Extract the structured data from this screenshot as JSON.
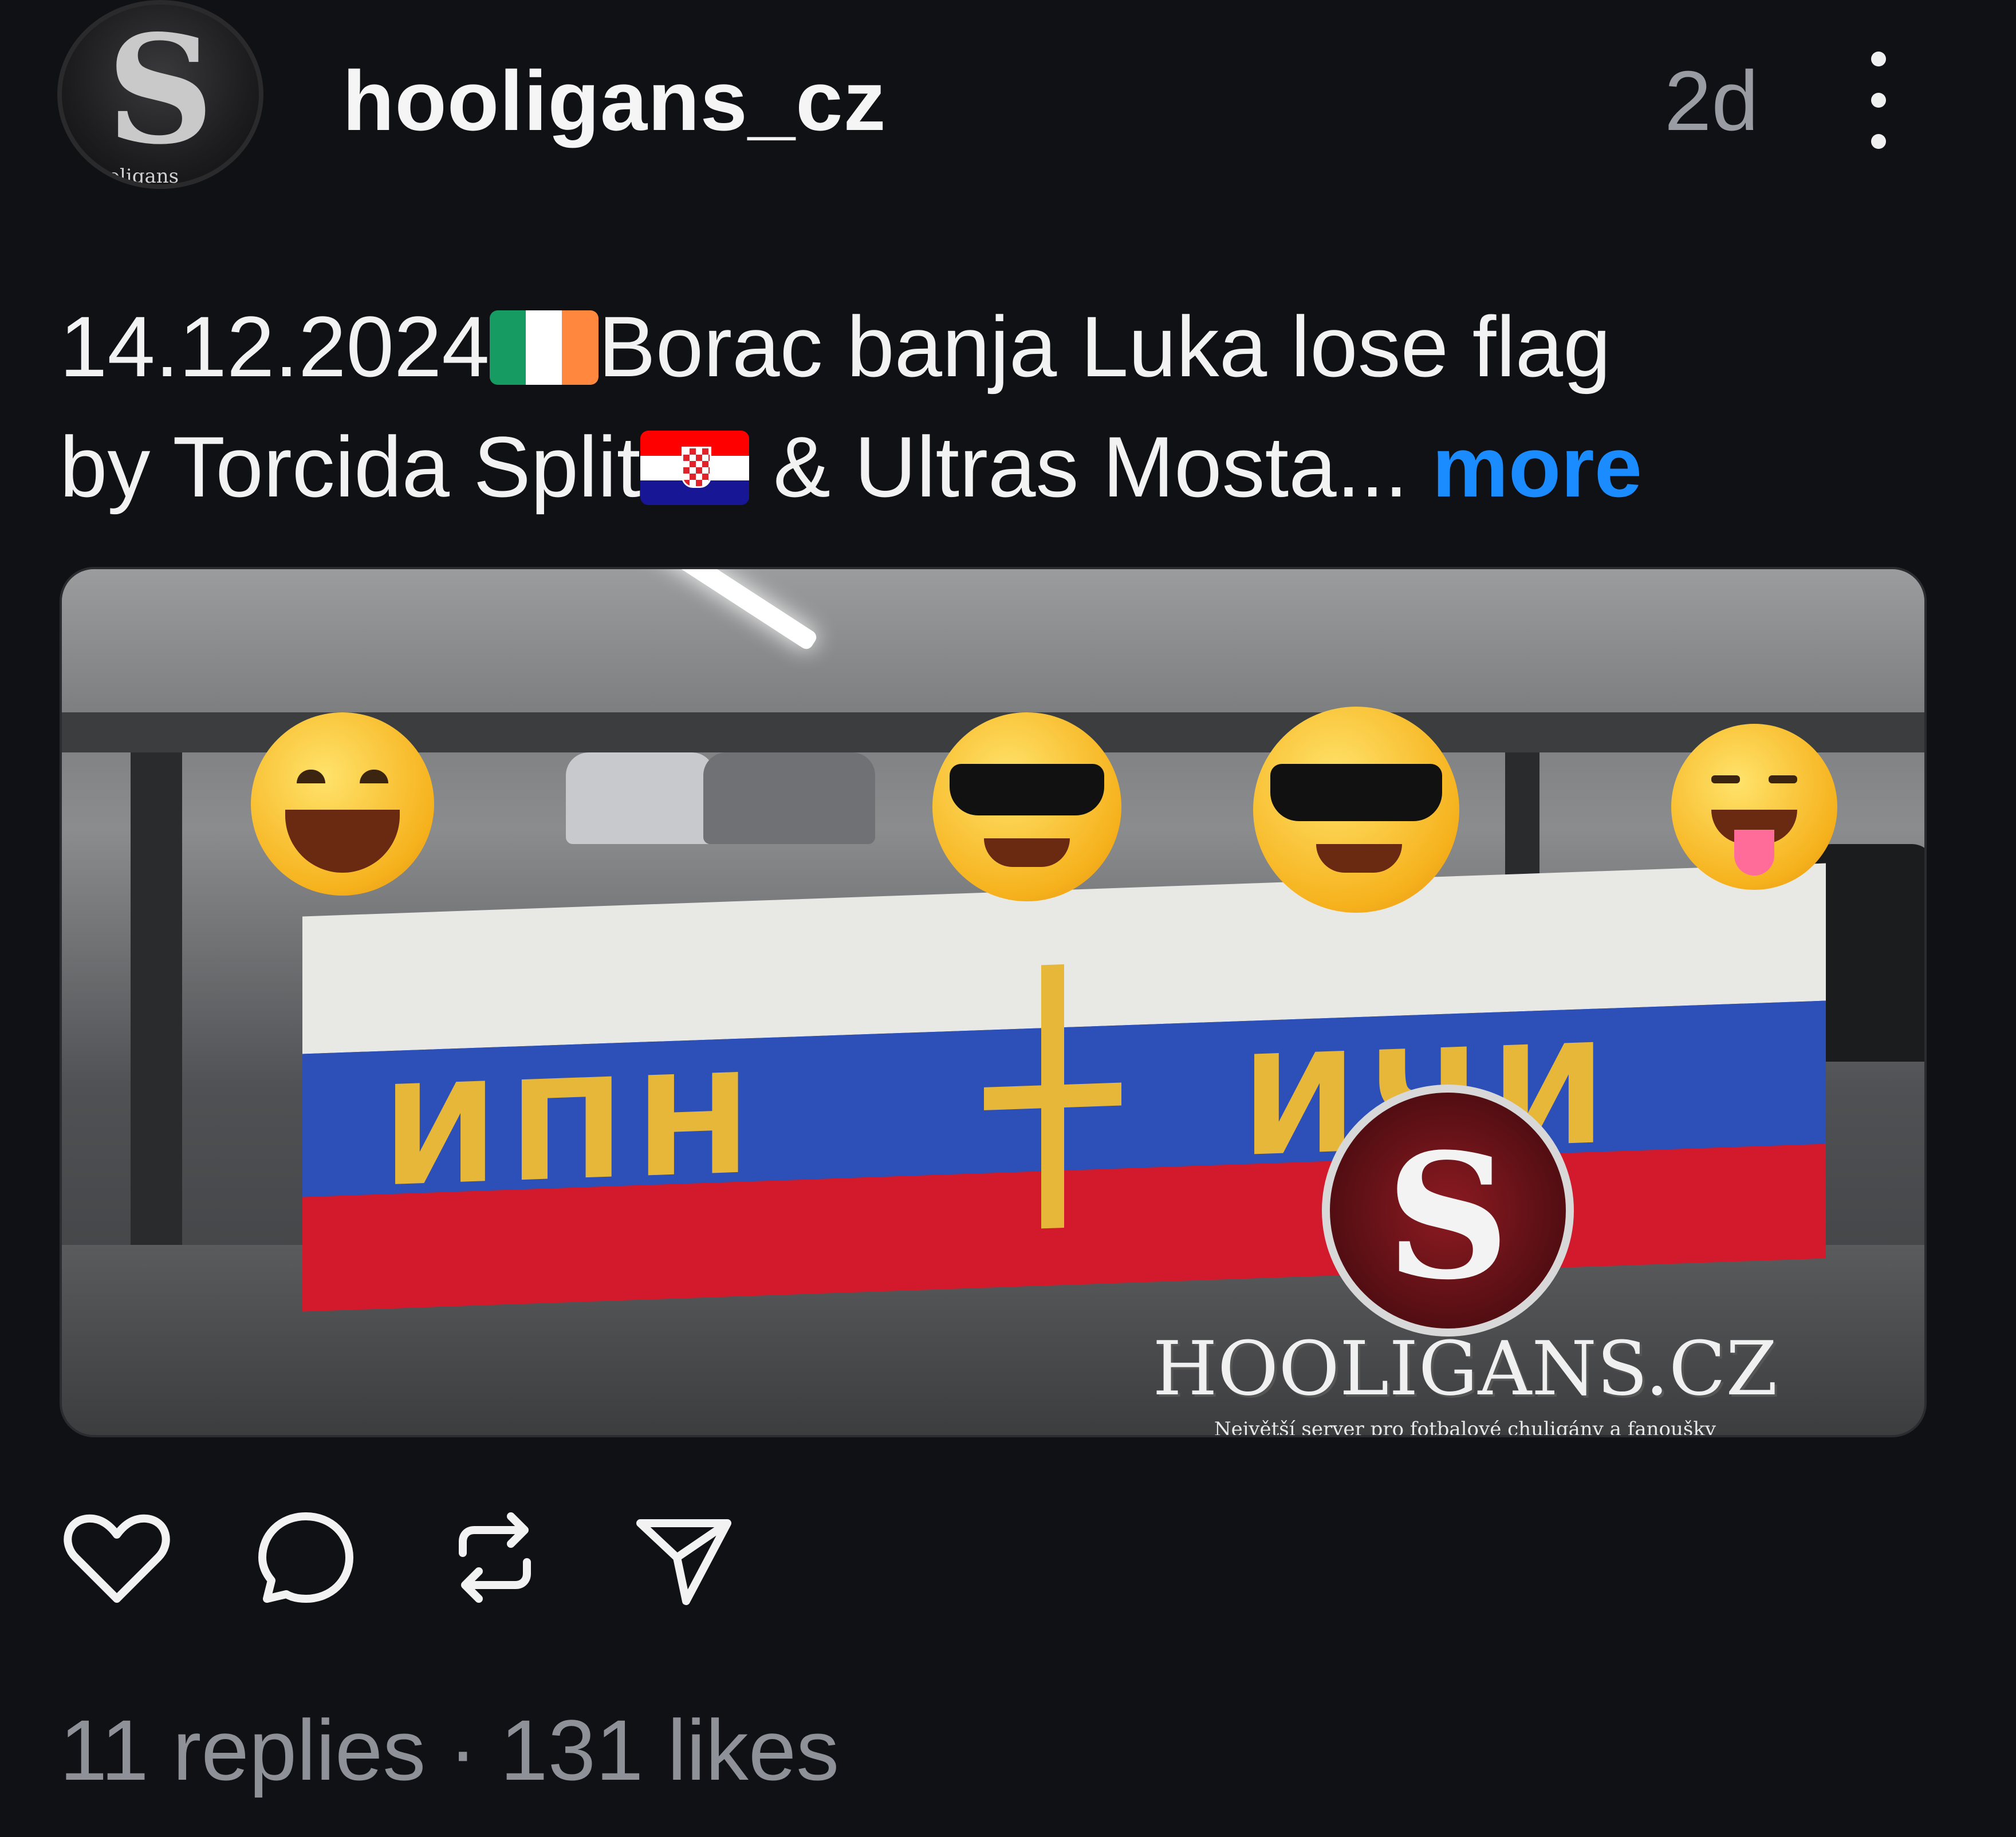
{
  "post": {
    "username": "hooligans_cz",
    "avatar_text": "ooligans",
    "avatar_glyph": "S",
    "time": "2d",
    "caption": {
      "date": "14.12.2024",
      "flag1": "ireland-flag",
      "part1": "Borac banja Luka lose flag",
      "part2": "by Torcida Split",
      "flag2": "croatia-flag",
      "part3": " & Ultras Mosta...",
      "more_label": "more"
    },
    "image": {
      "banner_text_left": "ИПН",
      "banner_text_right": "ИЧИ",
      "watermark_brand": "HOOLIGANS.CZ",
      "watermark_tag": "Největší server pro fotbalové chuligány a fanoušky",
      "watermark_glyph": "S"
    },
    "actions": [
      "heart-icon",
      "comment-icon",
      "repost-icon",
      "share-icon"
    ],
    "stats": {
      "replies": "11 replies",
      "separator": "·",
      "likes": "131 likes"
    }
  }
}
